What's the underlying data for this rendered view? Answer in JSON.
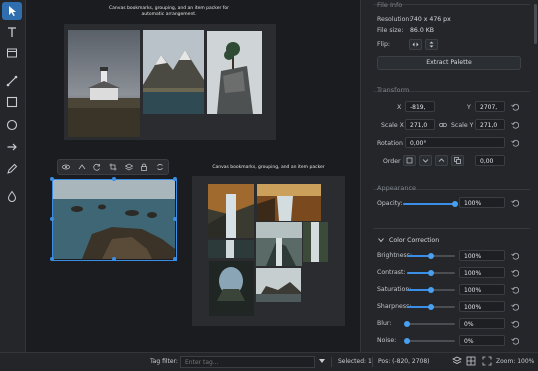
{
  "toolbar": {
    "tools": [
      "select-tool",
      "text-tool",
      "frame-tool",
      "line-tool",
      "rectangle-tool",
      "ellipse-tool",
      "arrow-tool",
      "pen-tool",
      "fill-tool"
    ]
  },
  "canvas": {
    "board1_title": "Canvas bookmarks, grouping, and an item packer for automatic arrangement.",
    "board2_title": "Canvas bookmarks, grouping, and an item packer"
  },
  "panel": {
    "file_info": {
      "title": "File Info",
      "resolution_label": "Resolution:",
      "resolution_value": "740 x 476 px",
      "filesize_label": "File size:",
      "filesize_value": "86.0 KB",
      "flip_label": "Flip:",
      "extract_label": "Extract Palette"
    },
    "transform": {
      "title": "Transform",
      "x_label": "X",
      "x_value": "-819,",
      "y_label": "Y",
      "y_value": "2707,",
      "scalex_label": "Scale X",
      "scalex_value": "271,0",
      "scaley_label": "Scale Y",
      "scaley_value": "271,0",
      "rotation_label": "Rotation",
      "rotation_value": "0,00°",
      "order_label": "Order",
      "order_value": "0,00"
    },
    "appearance": {
      "title": "Appearance",
      "opacity_label": "Opacity:",
      "opacity_value": "100%",
      "opacity_level": 1.0
    },
    "color": {
      "title": "Color Correction",
      "rows": [
        {
          "label": "Brightness:",
          "value": "100%",
          "level": 0.5
        },
        {
          "label": "Contrast:",
          "value": "100%",
          "level": 0.5
        },
        {
          "label": "Saturation:",
          "value": "100%",
          "level": 0.5
        },
        {
          "label": "Sharpness:",
          "value": "100%",
          "level": 0.5
        },
        {
          "label": "Blur:",
          "value": "0%",
          "level": 0.0
        },
        {
          "label": "Noise:",
          "value": "0%",
          "level": 0.0
        }
      ]
    }
  },
  "status": {
    "tag_filter_label": "Tag filter:",
    "tag_placeholder": "Enter tag...",
    "selected": "Selected: 1",
    "pos": "Pos: (-820, 2708)",
    "zoom": "Zoom: 100%"
  },
  "colors": {
    "accent": "#3a8ee6",
    "background": "#1e1f22",
    "panel": "#242629"
  }
}
